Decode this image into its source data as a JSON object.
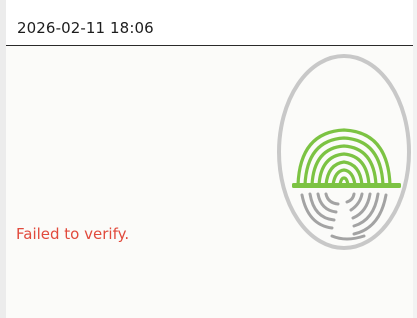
{
  "status_bar": {
    "datetime": "2026-02-11 18:06"
  },
  "verification": {
    "message": "Failed to verify.",
    "message_color": "#e14a3c",
    "icon": "fingerprint-icon",
    "scan_color": "#7cc343",
    "ring_color": "#c8c8c8"
  }
}
